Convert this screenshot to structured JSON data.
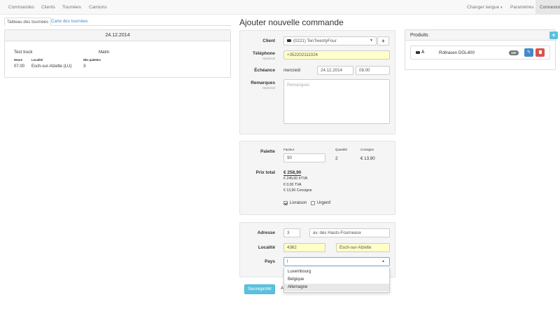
{
  "nav": {
    "commandes": "Commandes",
    "clients": "Clients",
    "tournees": "Tournées",
    "camions": "Camions",
    "langue": "Changer langue",
    "langue_caret": "▾",
    "parametres": "Paramètres",
    "connexion": "Connexion"
  },
  "left": {
    "tab_tableau": "Tableau des tournées",
    "tab_carte": "Carte des tournées",
    "day": {
      "date": "24.12.2014",
      "truck": "Test truck",
      "period": "Matin",
      "col_heure": "Heure",
      "col_localite": "Localité",
      "col_palettes": "Nbr palettes",
      "row": {
        "heure": "07.00",
        "localite": "Esch-sur-Alzette (LU)",
        "palettes": "3"
      }
    }
  },
  "form": {
    "title": "Ajouter nouvelle commande",
    "client_label": "Client",
    "client_value": "(0221) TenTwentyFour",
    "client_add": "+",
    "telephone_label": "Téléphone",
    "telephone_sub": "Optionnel",
    "telephone_value": "+352202111024",
    "echeance_label": "Échéance",
    "echeance_day": "mercredi",
    "echeance_date": "24.12.2014",
    "echeance_time": "08.00",
    "remarques_label": "Remarques",
    "remarques_sub": "Optionnel",
    "remarques_placeholder": "Remarques",
    "palette_label": "Palette",
    "facteur_label": "Facteur",
    "quantite_label": "Quantité",
    "consigne_label": "Consigne",
    "facteur_value": "90",
    "quantite_value": "2",
    "consigne_value": "€ 13,90",
    "prix_label": "Prix total",
    "prix_total": "€ 258,90",
    "prix_htva": "€ 245,00 hTVA",
    "prix_tva": "€ 0,00 TVA",
    "prix_consigne": "€ 13,90 Consigne",
    "livraison_label": "Livraison",
    "urgent_label": "Urgent!",
    "adresse_label": "Adresse",
    "adresse_num": "3",
    "adresse_rue": "av. des Hauts-Fourneaux",
    "localite_label": "Localité",
    "localite_cp": "4362",
    "localite_ville": "Esch-sur-Alzette",
    "pays_label": "Pays",
    "pays_value": "l",
    "pays_options": [
      "Luxembourg",
      "Belgique",
      "Allemagne"
    ],
    "save_label": "Sauvegarder",
    "annuler_partial": "A"
  },
  "produits": {
    "title": "Produits",
    "add": "+",
    "item_name": "Rollrasen DGL400",
    "item_badge": "100"
  }
}
